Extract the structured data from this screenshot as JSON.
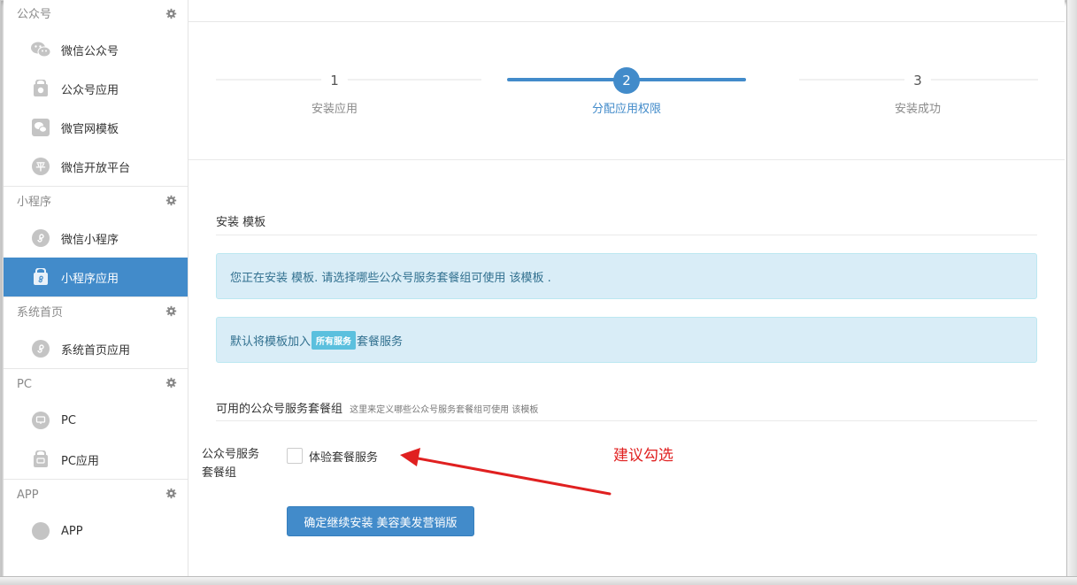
{
  "sidebar": {
    "groups": [
      {
        "title": "公众号",
        "items": [
          {
            "label": "微信公众号",
            "icon": "wechat-icon"
          },
          {
            "label": "公众号应用",
            "icon": "bag-icon"
          },
          {
            "label": "微官网模板",
            "icon": "template-icon"
          },
          {
            "label": "微信开放平台",
            "icon": "platform-icon",
            "glyph": "平"
          }
        ]
      },
      {
        "title": "小程序",
        "items": [
          {
            "label": "微信小程序",
            "icon": "miniprogram-icon"
          },
          {
            "label": "小程序应用",
            "icon": "miniprogram-bag-icon",
            "active": true
          }
        ]
      },
      {
        "title": "系统首页",
        "items": [
          {
            "label": "系统首页应用",
            "icon": "miniprogram-icon"
          }
        ]
      },
      {
        "title": "PC",
        "items": [
          {
            "label": "PC",
            "icon": "monitor-icon"
          },
          {
            "label": "PC应用",
            "icon": "monitor-bag-icon"
          }
        ]
      },
      {
        "title": "APP",
        "items": [
          {
            "label": "APP",
            "icon": "app-icon"
          }
        ]
      }
    ]
  },
  "steps": [
    {
      "num": "1",
      "label": "安装应用",
      "active": false
    },
    {
      "num": "2",
      "label": "分配应用权限",
      "active": true
    },
    {
      "num": "3",
      "label": "安装成功",
      "active": false
    }
  ],
  "section": {
    "title": "安装 模板"
  },
  "alerts": {
    "info": "您正在安装 模板. 请选择哪些公众号服务套餐组可使用 该模板 .",
    "default_prefix": "默认将模板加入",
    "default_badge": "所有服务",
    "default_suffix": "套餐服务"
  },
  "groups_section": {
    "title": "可用的公众号服务套餐组",
    "hint": "这里来定义哪些公众号服务套餐组可使用 该模板"
  },
  "field": {
    "label_line1": "公众号服务",
    "label_line2": "套餐组",
    "option": "体验套餐服务",
    "checked": false
  },
  "confirm_button": "确定继续安装 美容美发营销版",
  "annotation": {
    "text": "建议勾选",
    "color": "#e02020"
  },
  "colors": {
    "primary": "#428bca",
    "alert_bg": "#d9edf7",
    "alert_text": "#31708f"
  }
}
